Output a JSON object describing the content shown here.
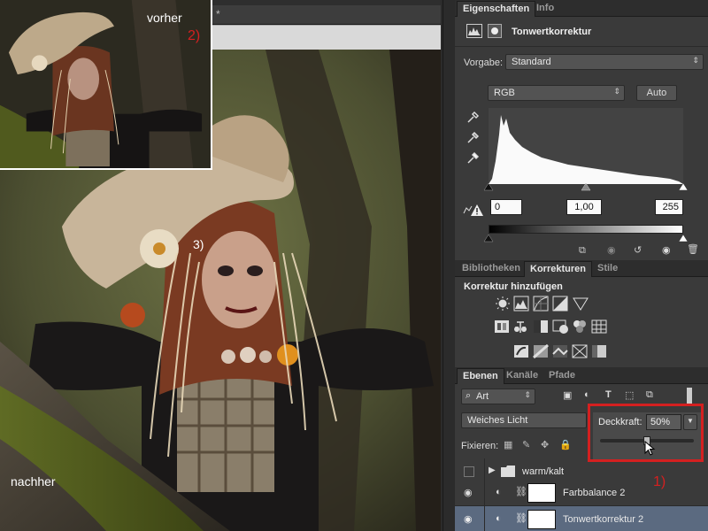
{
  "canvas": {
    "tab_marker": "*",
    "label_before": "vorher",
    "label_after": "nachher",
    "marker_1": "1)",
    "marker_2": "2)",
    "marker_3": "3)"
  },
  "properties": {
    "tabs": [
      "Eigenschaften",
      "Info"
    ],
    "adjustment_title": "Tonwertkorrektur",
    "preset_label": "Vorgabe:",
    "preset_value": "Standard",
    "channel_value": "RGB",
    "auto_label": "Auto",
    "input_black": "0",
    "input_gamma": "1,00",
    "input_white": "255"
  },
  "adjustments": {
    "tabs": [
      "Bibliotheken",
      "Korrekturen",
      "Stile"
    ],
    "heading": "Korrektur hinzufügen"
  },
  "layers": {
    "tabs": [
      "Ebenen",
      "Kanäle",
      "Pfade"
    ],
    "filter_value": "Art",
    "blend_mode": "Weiches Licht",
    "opacity_label": "Deckkraft:",
    "opacity_value": "50%",
    "opacity_level": 0.5,
    "lock_label": "Fixieren:",
    "items": [
      {
        "name": "warm/kalt",
        "type": "group"
      },
      {
        "name": "Farbbalance 2",
        "type": "adjustment"
      },
      {
        "name": "Tonwertkorrektur 2",
        "type": "adjustment",
        "selected": true
      }
    ]
  },
  "colors": {
    "annotation_red": "#d42020",
    "selected_row": "#5b6a80",
    "panel_bg": "#3a3a3a"
  }
}
